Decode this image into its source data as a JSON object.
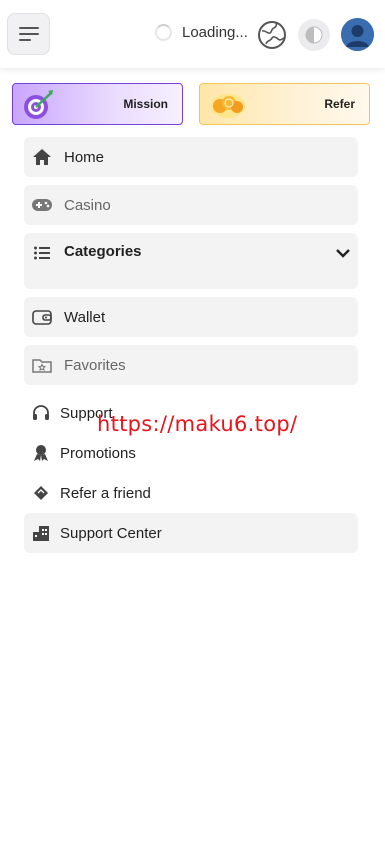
{
  "header": {
    "loading_text": "Loading...",
    "icons": [
      "hamburger-icon",
      "globe-icon",
      "theme-toggle-icon",
      "avatar"
    ]
  },
  "promos": {
    "mission_label": "Mission",
    "refer_label": "Refer"
  },
  "nav": {
    "home": "Home",
    "casino": "Casino",
    "categories": "Categories",
    "wallet": "Wallet",
    "favorites": "Favorites",
    "support": "Support",
    "promotions": "Promotions",
    "refer_friend": "Refer a friend",
    "support_center": "Support Center"
  },
  "overlay": {
    "url_text": "https://maku6.top/"
  },
  "colors": {
    "mission_border": "#7a3fd6",
    "refer_border": "#f2c55b",
    "watermark": "#e8141a",
    "item_bg": "#f3f3f4"
  }
}
